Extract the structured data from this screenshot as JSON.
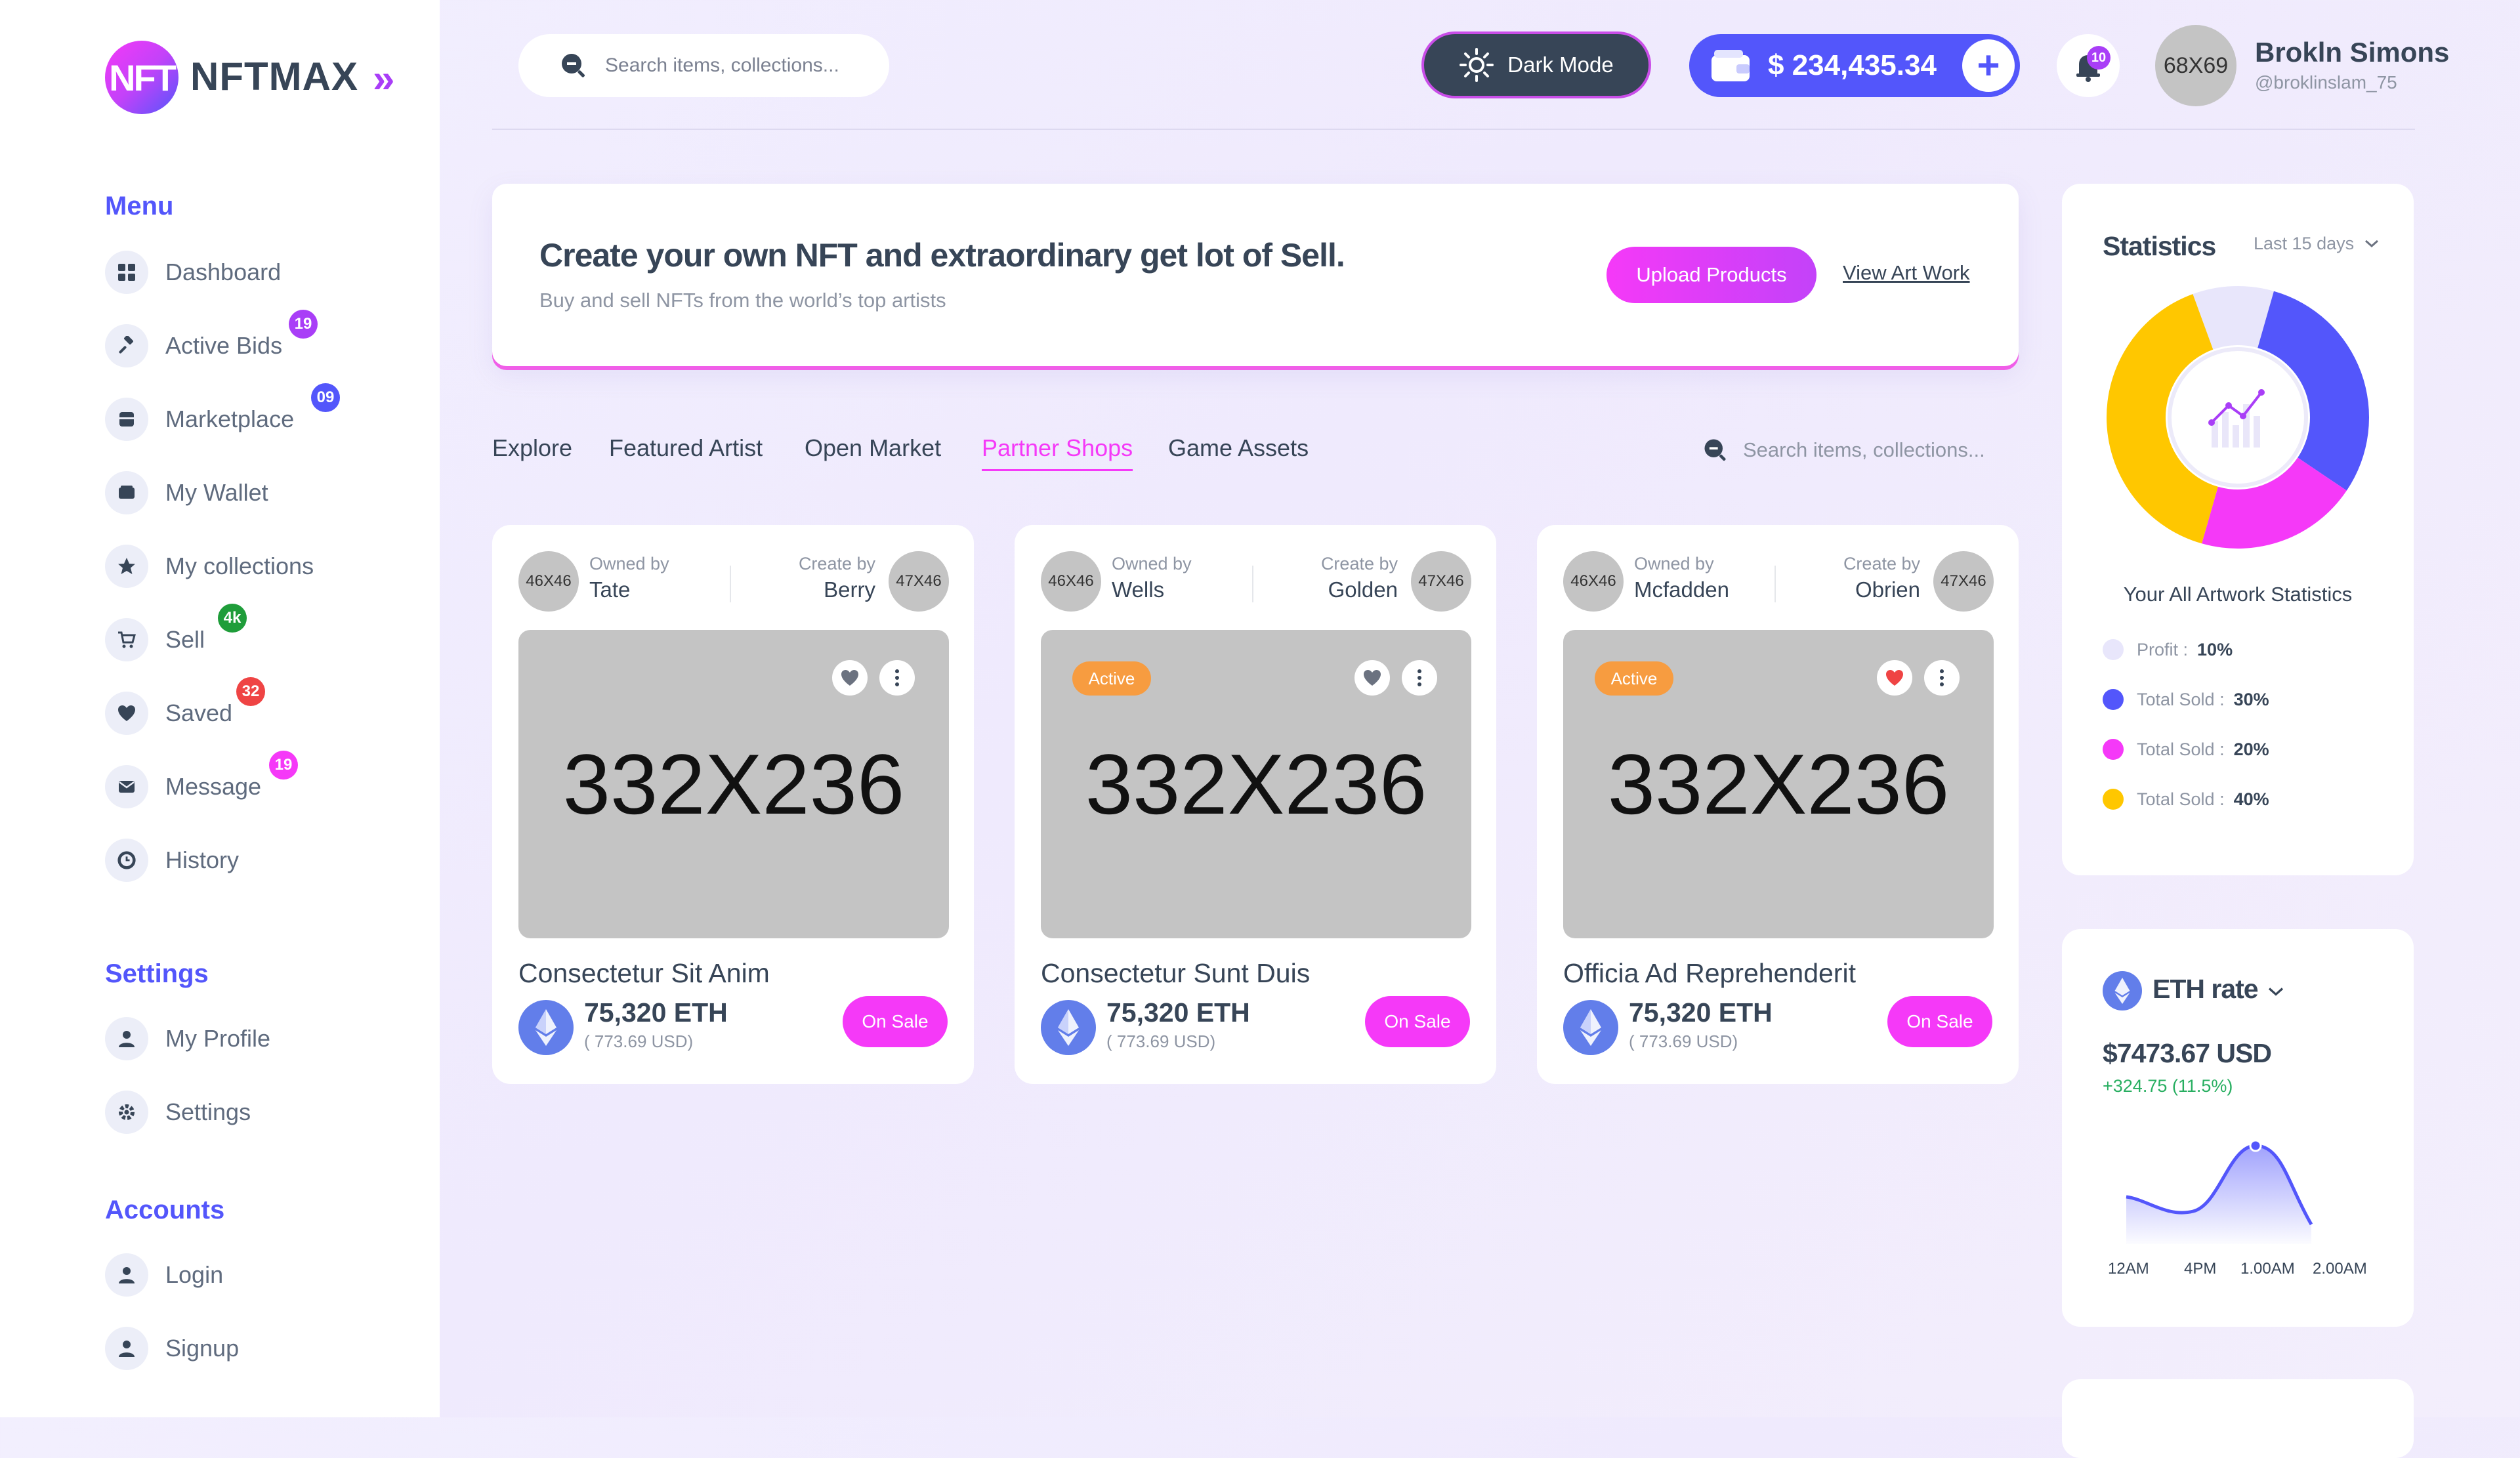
{
  "brand": {
    "logo_mark": "NFT",
    "name": "NFTMAX"
  },
  "sidebar": {
    "menu_title": "Menu",
    "menu": [
      {
        "label": "Dashboard",
        "icon": "grid-icon",
        "badge": null
      },
      {
        "label": "Active Bids",
        "icon": "gavel-icon",
        "badge": "19",
        "badge_color": "#a93ef7"
      },
      {
        "label": "Marketplace",
        "icon": "store-icon",
        "badge": "09",
        "badge_color": "#5356fb"
      },
      {
        "label": "My Wallet",
        "icon": "wallet-icon",
        "badge": null
      },
      {
        "label": "My collections",
        "icon": "star-icon",
        "badge": null
      },
      {
        "label": "Sell",
        "icon": "cart-icon",
        "badge": "4k",
        "badge_color": "#1f9d3a"
      },
      {
        "label": "Saved",
        "icon": "heart-icon",
        "badge": "32",
        "badge_color": "#ef4444"
      },
      {
        "label": "Message",
        "icon": "mail-icon",
        "badge": "19",
        "badge_color": "#f539f8"
      },
      {
        "label": "History",
        "icon": "clock-icon",
        "badge": null
      }
    ],
    "settings_title": "Settings",
    "settings": [
      {
        "label": "My Profile",
        "icon": "user-icon"
      },
      {
        "label": "Settings",
        "icon": "gear-icon"
      }
    ],
    "accounts_title": "Accounts",
    "accounts": [
      {
        "label": "Login",
        "icon": "user-icon"
      },
      {
        "label": "Signup",
        "icon": "user-icon"
      }
    ]
  },
  "topbar": {
    "search_placeholder": "Search items, collections...",
    "dark_mode_label": "Dark Mode",
    "wallet_balance": "$ 234,435.34",
    "notification_count": "10",
    "avatar_placeholder": "68X69",
    "user_name": "Brokln Simons",
    "user_handle": "@broklinslam_75"
  },
  "hero": {
    "title": "Create your own NFT and extraordinary get lot of Sell.",
    "subtitle": "Buy and sell NFTs from the world’s top artists",
    "primary_button": "Upload Products",
    "secondary_link": "View Art Work"
  },
  "tabs": [
    {
      "label": "Explore",
      "active": false
    },
    {
      "label": "Featured Artist",
      "active": false
    },
    {
      "label": "Open Market",
      "active": false
    },
    {
      "label": "Partner Shops",
      "active": true
    },
    {
      "label": "Game Assets",
      "active": false
    }
  ],
  "tab_search_placeholder": "Search items, collections...",
  "cards": [
    {
      "owner_avatar": "46X46",
      "owner_label": "Owned by",
      "owner": "Tate",
      "creator_label": "Create by",
      "creator": "Berry",
      "creator_avatar": "47X46",
      "image_placeholder": "332X236",
      "active_badge": null,
      "liked": false,
      "title": "Consectetur Sit Anim",
      "price": "75,320 ETH",
      "usd": "( 773.69 USD)",
      "button": "On Sale"
    },
    {
      "owner_avatar": "46X46",
      "owner_label": "Owned by",
      "owner": "Wells",
      "creator_label": "Create by",
      "creator": "Golden",
      "creator_avatar": "47X46",
      "image_placeholder": "332X236",
      "active_badge": "Active",
      "liked": false,
      "title": "Consectetur Sunt Duis",
      "price": "75,320 ETH",
      "usd": "( 773.69 USD)",
      "button": "On Sale"
    },
    {
      "owner_avatar": "46X46",
      "owner_label": "Owned by",
      "owner": "Mcfadden",
      "creator_label": "Create by",
      "creator": "Obrien",
      "creator_avatar": "47X46",
      "image_placeholder": "332X236",
      "active_badge": "Active",
      "liked": true,
      "title": "Officia Ad Reprehenderit",
      "price": "75,320 ETH",
      "usd": "( 773.69 USD)",
      "button": "On Sale"
    }
  ],
  "statistics": {
    "title": "Statistics",
    "range": "Last 15 days",
    "caption": "Your All Artwork Statistics",
    "legend": [
      {
        "label": "Profit :",
        "value": "10%",
        "color": "#e8e6fb"
      },
      {
        "label": "Total Sold :",
        "value": "30%",
        "color": "#5356fb"
      },
      {
        "label": "Total Sold :",
        "value": "20%",
        "color": "#f539f8"
      },
      {
        "label": "Total Sold :",
        "value": "40%",
        "color": "#ffc700"
      }
    ]
  },
  "eth_rate": {
    "title": "ETH rate",
    "value": "$7473.67 USD",
    "change": "+324.75 (11.5%)",
    "ticks": [
      "12AM",
      "4PM",
      "1.00AM",
      "2.00AM"
    ]
  },
  "colors": {
    "accent": "#5356fb",
    "pink": "#f539f8",
    "yellow": "#ffc700",
    "orange": "#f79c40",
    "green": "#27ae60"
  }
}
